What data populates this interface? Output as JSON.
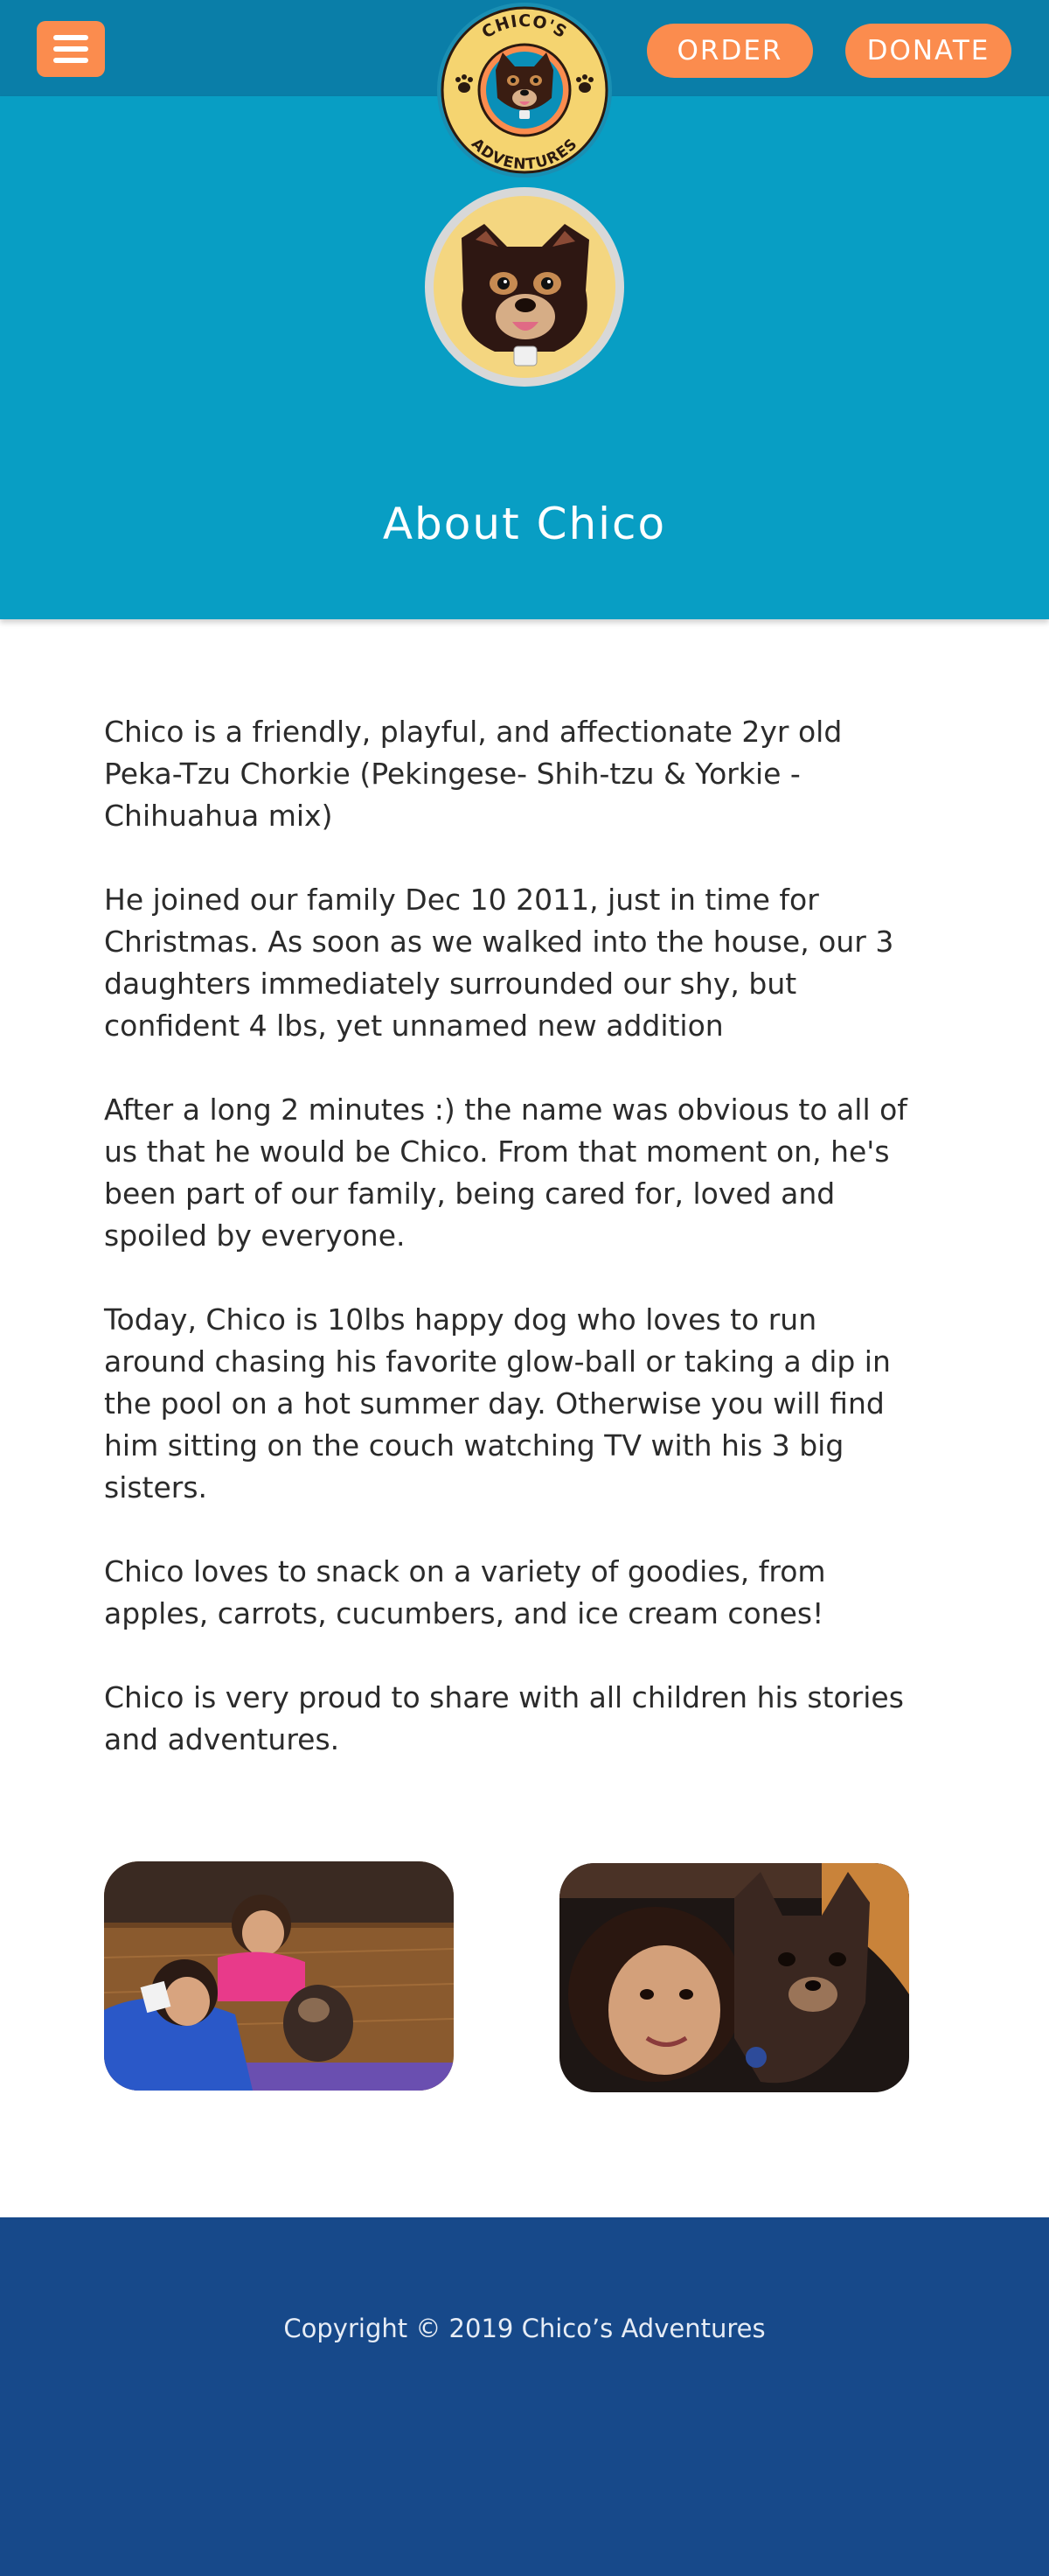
{
  "header": {
    "menu_icon": "hamburger-menu-icon",
    "order_label": "ORDER",
    "donate_label": "DONATE",
    "logo": {
      "top_text": "CHICO'S",
      "bottom_text": "ADVENTURES"
    }
  },
  "hero": {
    "title": "About Chico"
  },
  "content": {
    "paragraphs": [
      "Chico is a friendly, playful, and affectionate 2yr old Peka-Tzu Chorkie (Pekingese- Shih-tzu & Yorkie -Chihuahua mix)",
      "He joined our family Dec 10 2011, just in time for Christmas. As soon as we walked into the house, our 3 daughters immediately surrounded our shy, but confident 4 lbs, yet unnamed new addition",
      "After a long 2 minutes :) the name was obvious to all of us that he would be Chico. From that moment on, he's been part of our family, being cared for, loved and spoiled by everyone.",
      "Today, Chico is 10lbs happy dog who loves to run around chasing his favorite glow-ball or taking a dip in the pool on a hot summer day. Otherwise you will find him sitting on the couch watching TV with his 3 big sisters.",
      "Chico loves to snack on a variety of goodies, from apples, carrots, cucumbers, and ice cream cones!",
      "Chico is very proud to share with all children his stories and adventures."
    ]
  },
  "footer": {
    "copyright": "Copyright © 2019 Chico’s Adventures"
  },
  "colors": {
    "topbar": "#0a7ea8",
    "hero": "#089ec4",
    "accent": "#fb8c4e",
    "footer": "#17498a"
  }
}
